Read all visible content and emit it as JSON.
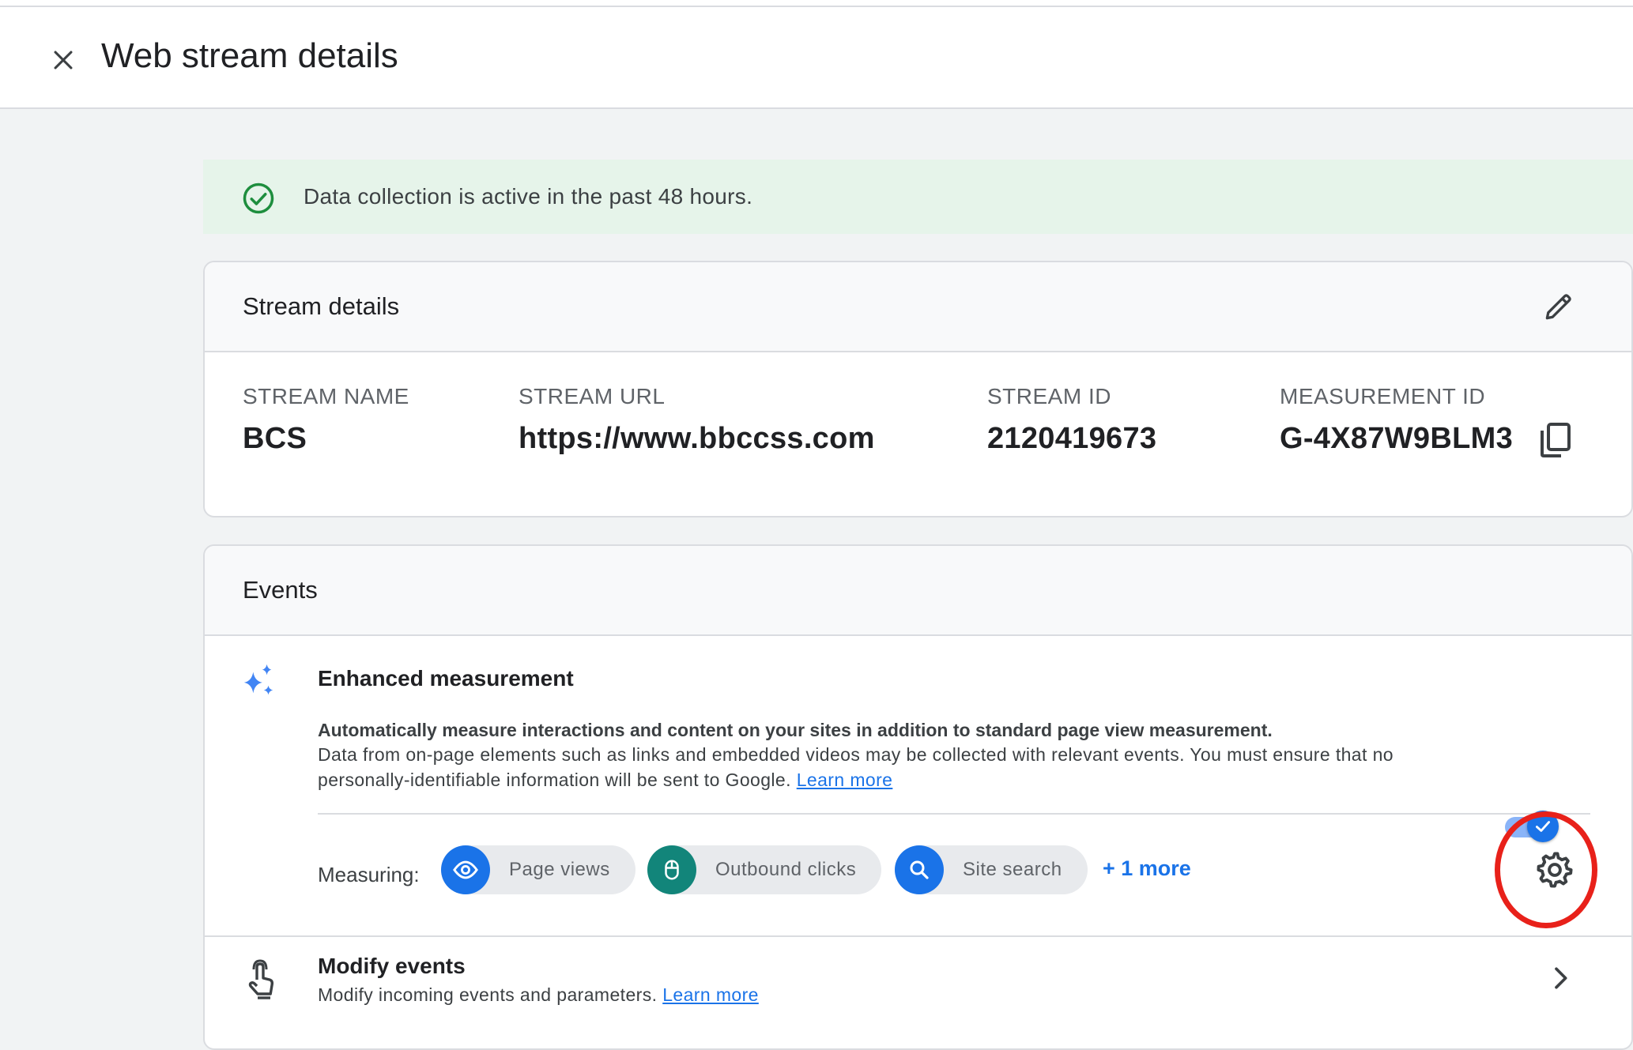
{
  "header": {
    "title": "Web stream details",
    "close_icon": "close-icon"
  },
  "banner": {
    "icon": "check-circle-icon",
    "text": "Data collection is active in the past 48 hours.",
    "color": "#1e8e3e"
  },
  "stream_details": {
    "title": "Stream details",
    "edit_icon": "pencil-icon",
    "fields": [
      {
        "label": "STREAM NAME",
        "value": "BCS"
      },
      {
        "label": "STREAM URL",
        "value": "https://www.bbccss.com"
      },
      {
        "label": "STREAM ID",
        "value": "2120419673"
      },
      {
        "label": "MEASUREMENT ID",
        "value": "G-4X87W9BLM3"
      }
    ],
    "copy_icon": "copy-icon"
  },
  "events": {
    "title": "Events",
    "enhanced": {
      "icon": "sparkle-icon",
      "title": "Enhanced measurement",
      "bold_text": "Automatically measure interactions and content on your sites in addition to standard page view measurement.",
      "text": "Data from on-page elements such as links and embedded videos may be collected with relevant events. You must ensure that no personally-identifiable information will be sent to Google.",
      "learn_more": "Learn more",
      "toggle_on": true
    },
    "measuring": {
      "label": "Measuring:",
      "chips": [
        {
          "label": "Page views",
          "icon": "eye-icon",
          "color": "#1a73e8"
        },
        {
          "label": "Outbound clicks",
          "icon": "mouse-icon",
          "color": "#12857a"
        },
        {
          "label": "Site search",
          "icon": "search-icon",
          "color": "#1a73e8"
        }
      ],
      "more": "+ 1 more",
      "settings_icon": "gear-icon"
    },
    "modify": {
      "icon": "touch-icon",
      "title": "Modify events",
      "subtitle": "Modify incoming events and parameters.",
      "learn_more": "Learn more"
    }
  },
  "colors": {
    "accent": "#1a73e8",
    "highlight_circle": "#e8211a"
  }
}
